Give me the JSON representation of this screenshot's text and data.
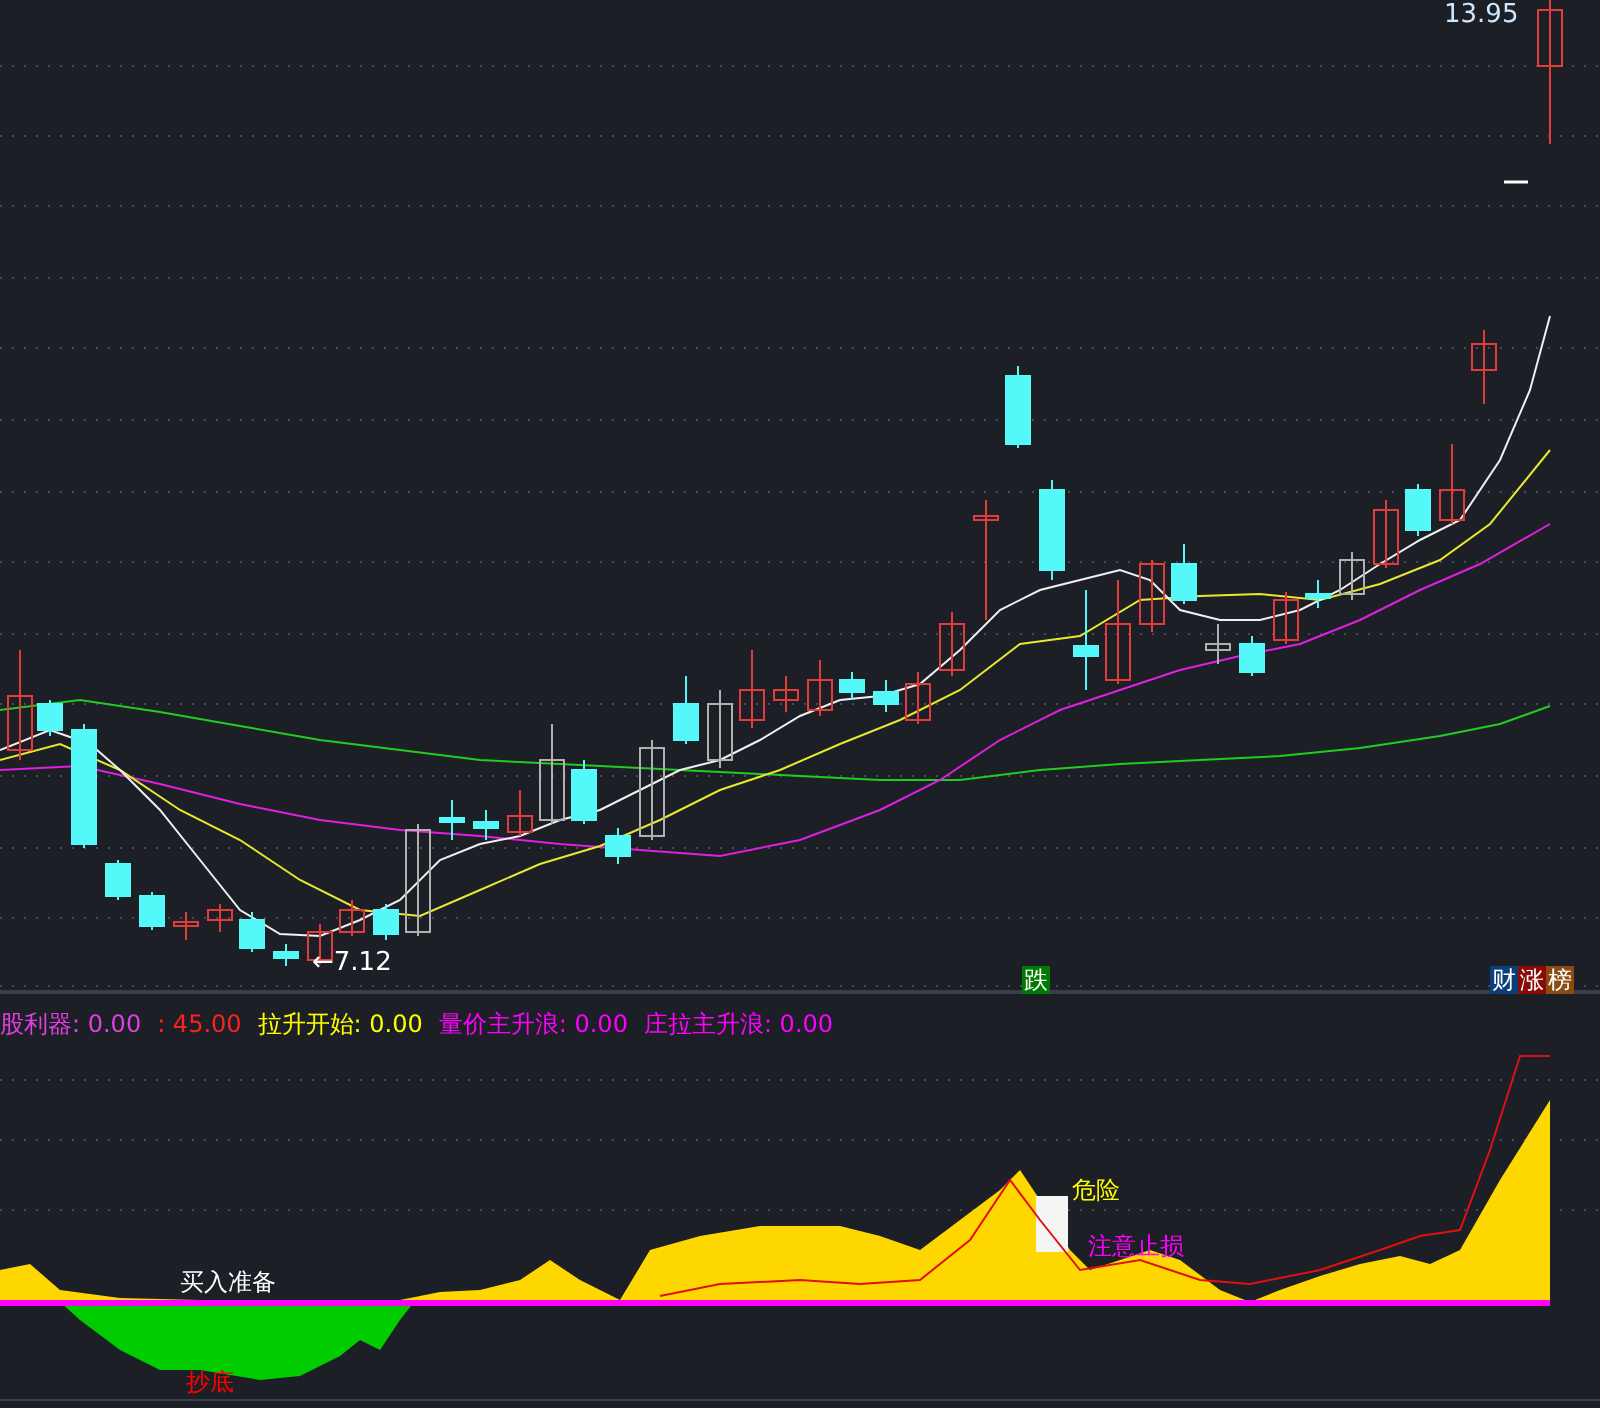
{
  "price_chart": {
    "high_label": "13.95",
    "low_label": "←7.12",
    "signals": [
      {
        "text": "跌",
        "color": "#007a00"
      },
      {
        "text": "财",
        "color": "#0b3f7a"
      },
      {
        "text": "涨",
        "color": "#8a0a0a"
      },
      {
        "text": "榜",
        "color": "#8a4a10"
      }
    ]
  },
  "indicator": {
    "legend": [
      {
        "text": "股利器: 0.00",
        "color": "#e040e0"
      },
      {
        "text": ": 45.00",
        "color": "#ff2020"
      },
      {
        "text": "拉升开始: 0.00",
        "color": "#ffff00"
      },
      {
        "text": "量价主升浪: 0.00",
        "color": "#ff00ff"
      },
      {
        "text": "庄拉主升浪: 0.00",
        "color": "#ff00ff"
      }
    ],
    "labels": [
      {
        "text": "买入准备",
        "color": "#ffffff"
      },
      {
        "text": "抄底",
        "color": "#ff0000"
      },
      {
        "text": "危险",
        "color": "#ffff00"
      },
      {
        "text": "注意止损",
        "color": "#ff00ff"
      }
    ]
  }
}
